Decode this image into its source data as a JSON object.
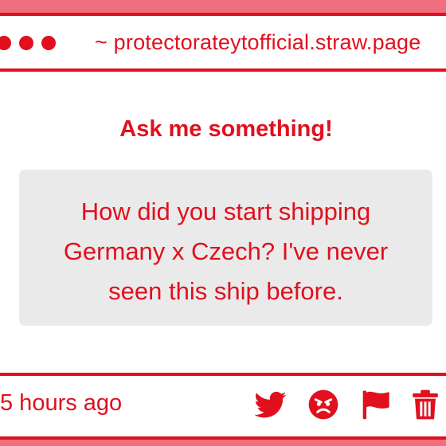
{
  "browser": {
    "url": "~ protectorateytofficial.straw.page"
  },
  "main": {
    "title": "Ask me something!",
    "question": "How did you start shipping Germany x Czech? I've never seen this ship before."
  },
  "footer": {
    "timestamp": "5 hours ago",
    "icons": [
      "twitter-icon",
      "angry-face-icon",
      "flag-icon",
      "trash-icon"
    ]
  },
  "colors": {
    "accent": "#e0101e",
    "background": "#ef6f7e",
    "card": "#eaeaea"
  }
}
